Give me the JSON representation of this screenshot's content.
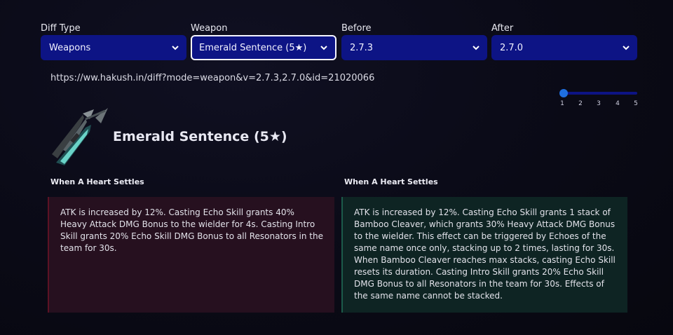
{
  "filters": {
    "diff_type": {
      "label": "Diff Type",
      "value": "Weapons"
    },
    "weapon": {
      "label": "Weapon",
      "value": "Emerald Sentence (5★)"
    },
    "before": {
      "label": "Before",
      "value": "2.7.3"
    },
    "after": {
      "label": "After",
      "value": "2.7.0"
    }
  },
  "url": "https://ww.hakush.in/diff?mode=weapon&v=2.7.3,2.7.0&id=21020066",
  "slider": {
    "ticks": [
      "1",
      "2",
      "3",
      "4",
      "5"
    ],
    "value": 1
  },
  "weapon": {
    "name": "Emerald Sentence (5★)"
  },
  "before": {
    "skill_name": "When A Heart Settles",
    "lines": [
      "ATK is increased by 12%. Casting Echo Skill grants 40% Heavy Attack DMG Bonus to the wielder for 4s. Casting Intro Skill grants 20% Echo Skill DMG Bonus to all Resonators in the team for 30s."
    ]
  },
  "after": {
    "skill_name": "When A Heart Settles",
    "lines": [
      "ATK is increased by 12%. Casting Echo Skill grants 1 stack of Bamboo Cleaver, which grants 30% Heavy Attack DMG Bonus to the wielder. This effect can be triggered by Echoes of the same name once only, stacking up to 2 times, lasting for 30s.",
      "When Bamboo Cleaver reaches max stacks, casting Echo Skill resets its duration. Casting Intro Skill grants 20% Echo Skill DMG Bonus to all Resonators in the team for 30s. Effects of the same name cannot be stacked."
    ]
  },
  "colors": {
    "select_bg": "#0d1485",
    "before_panel": "#26101f",
    "after_panel": "#0e2423",
    "slider_thumb": "#1f6fe0"
  },
  "icons": [
    "chevron-down-icon",
    "weapon-image"
  ]
}
